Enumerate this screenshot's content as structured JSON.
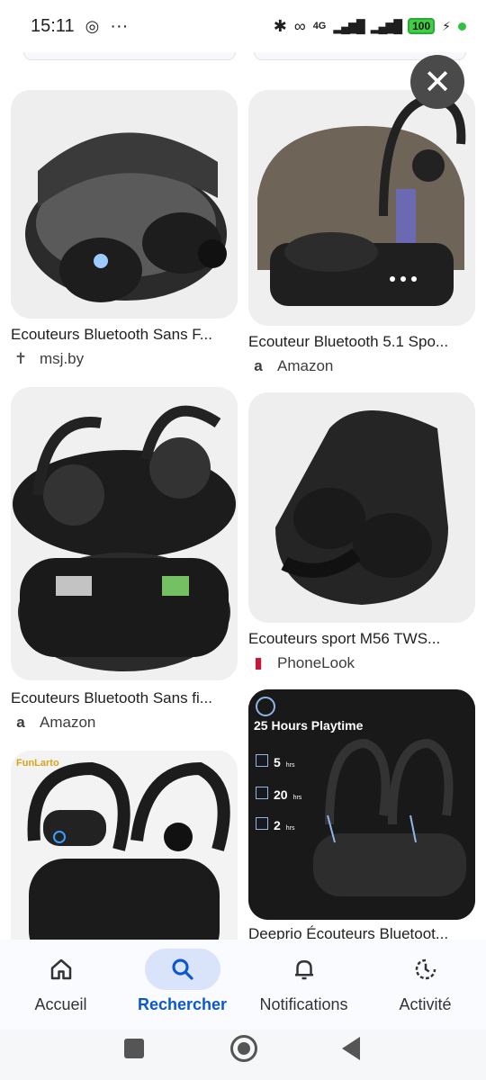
{
  "status_bar": {
    "time": "15:11",
    "network": "4G",
    "battery": "100"
  },
  "results": [
    {
      "caption": "Ecouteurs Bluetooth Sans F...",
      "source": "msj.by",
      "source_icon": "cross-icon"
    },
    {
      "caption": "Ecouteur Bluetooth 5.1 Spo...",
      "source": "Amazon",
      "source_icon": "amazon-icon"
    },
    {
      "caption": "Ecouteurs Bluetooth Sans fi...",
      "source": "Amazon",
      "source_icon": "amazon-icon"
    },
    {
      "caption": "Ecouteurs sport M56 TWS...",
      "source": "PhoneLook",
      "source_icon": "phonelook-icon"
    },
    {
      "caption": "",
      "source": "",
      "brand": "FunLarto"
    },
    {
      "caption": "Deeprio Écouteurs Bluetoot...",
      "source": "",
      "overlay": {
        "title": "25 Hours Playtime",
        "stats": [
          {
            "value": "5",
            "unit": "hrs"
          },
          {
            "value": "20",
            "unit": "hrs"
          },
          {
            "value": "2",
            "unit": "hrs"
          }
        ]
      }
    }
  ],
  "bottom_nav": [
    {
      "label": "Accueil",
      "icon": "home-icon"
    },
    {
      "label": "Rechercher",
      "icon": "search-icon"
    },
    {
      "label": "Notifications",
      "icon": "bell-icon"
    },
    {
      "label": "Activité",
      "icon": "activity-icon"
    }
  ],
  "colors": {
    "accent": "#0b57d0",
    "active_pill": "#d9e4fb"
  }
}
